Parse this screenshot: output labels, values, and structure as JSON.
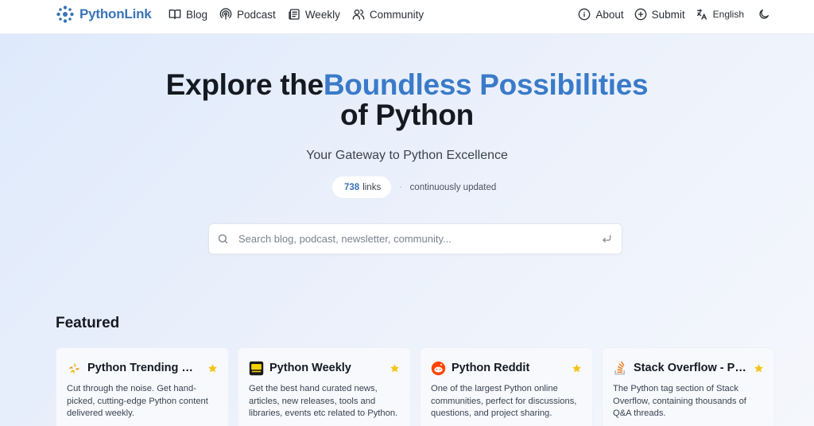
{
  "header": {
    "logo_text": "PythonLink",
    "nav": [
      {
        "label": "Blog",
        "icon": "book-icon"
      },
      {
        "label": "Podcast",
        "icon": "podcast-icon"
      },
      {
        "label": "Weekly",
        "icon": "newspaper-icon"
      },
      {
        "label": "Community",
        "icon": "users-icon"
      }
    ],
    "right_nav": [
      {
        "label": "About",
        "icon": "info-icon"
      },
      {
        "label": "Submit",
        "icon": "plus-circle-icon"
      },
      {
        "label": "English",
        "icon": "translate-icon"
      }
    ],
    "theme_icon": "moon-icon"
  },
  "hero": {
    "title_prefix": "Explore the",
    "title_accent": "Boundless Possibilities",
    "title_suffix": "of Python",
    "subtitle": "Your Gateway to Python Excellence",
    "links_count": "738",
    "links_label": "links",
    "separator": "·",
    "updated_text": "continuously updated"
  },
  "search": {
    "placeholder": "Search blog, podcast, newsletter, community..."
  },
  "featured": {
    "title": "Featured",
    "cards": [
      {
        "title": "Python Trending Weekly",
        "desc": "Cut through the noise. Get hand-picked, cutting-edge Python content delivered weekly.",
        "icon": "trending-logo-icon"
      },
      {
        "title": "Python Weekly",
        "desc": "Get the best hand curated news, articles, new releases, tools and libraries, events etc related to Python.",
        "icon": "python-weekly-logo-icon"
      },
      {
        "title": "Python Reddit",
        "desc": "One of the largest Python online communities, perfect for discussions, questions, and project sharing.",
        "icon": "reddit-logo-icon"
      },
      {
        "title": "Stack Overflow - Python",
        "desc": "The Python tag section of Stack Overflow, containing thousands of Q&A threads.",
        "icon": "stackoverflow-logo-icon"
      }
    ]
  },
  "colors": {
    "accent": "#3a7ac9",
    "star": "#f5c518"
  }
}
